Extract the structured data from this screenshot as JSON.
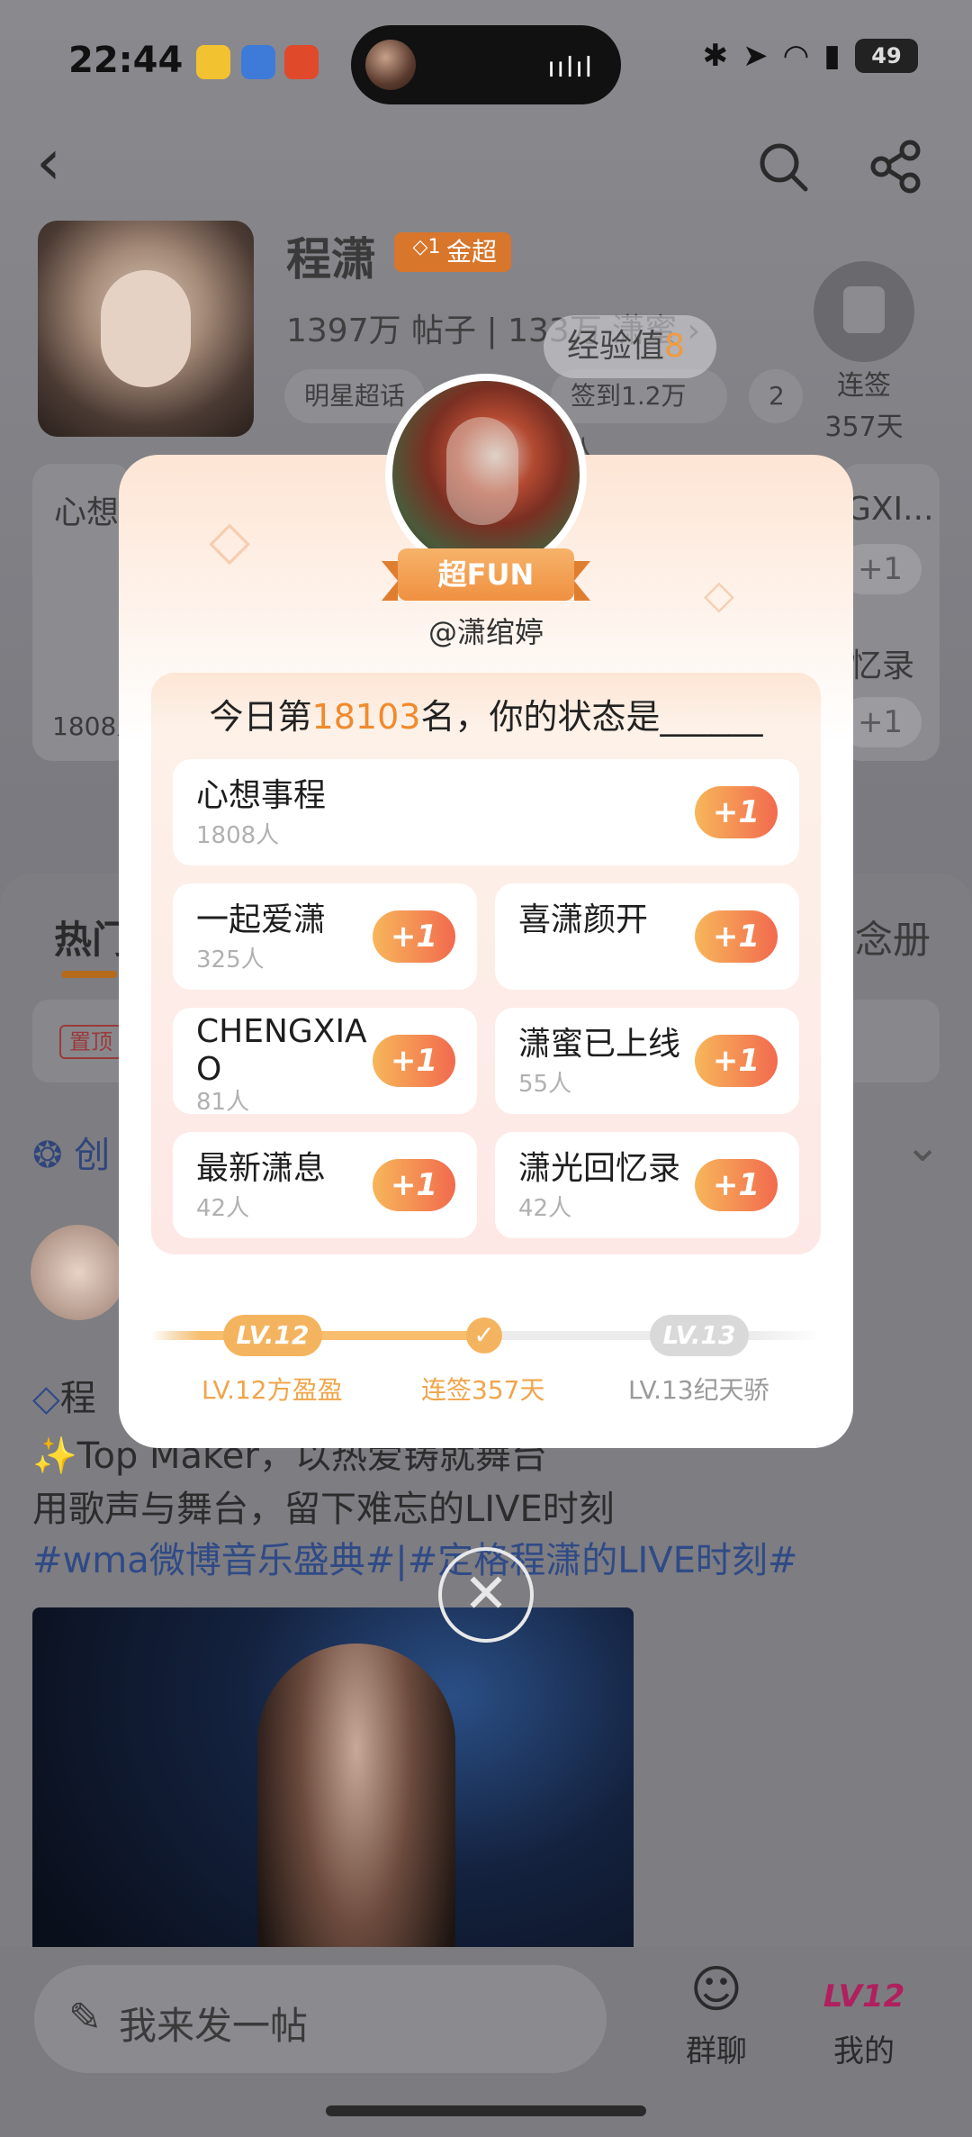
{
  "status_bar": {
    "time": "22:44",
    "battery": "49",
    "wave": "ıılıl"
  },
  "header": {
    "title": "程潇",
    "badge": "金超",
    "badge_num": "1",
    "stats": "1397万 帖子 | 133万 潇蜜 ›",
    "tags": [
      "明星超话",
      "签到1.2万人",
      "2"
    ],
    "checkin_label": "连签",
    "checkin_days": "357天",
    "exp_label": "经验值",
    "exp_value": "8"
  },
  "side_cards": {
    "left_title": "心想",
    "left_count": "1808人",
    "right_title": "GXI...",
    "right_title2": "忆录",
    "plus": "+1"
  },
  "tabs": {
    "hot": "热门",
    "right": "念册"
  },
  "pin": {
    "badge": "置顶"
  },
  "create": {
    "label": "创"
  },
  "post": {
    "line1": "程",
    "line2": "✨Top Maker，以热爱铸就舞台",
    "line3": "用歌声与舞台，留下难忘的LIVE时刻",
    "hashtags": "#wma微博音乐盛典#|#定格程潇的LIVE时刻#"
  },
  "bottom": {
    "compose_placeholder": "我来发一帖",
    "group_chat": "群聊",
    "mine": "我的",
    "mine_level": "LV12"
  },
  "modal": {
    "ribbon": "超FUN",
    "handle": "@潇绾婷",
    "rank_prefix": "今日第",
    "rank": "18103",
    "rank_suffix": "名，你的状态是______",
    "plus_label": "+1",
    "options": [
      {
        "name": "心想事程",
        "count": "1808人"
      },
      {
        "name": "一起爱潇",
        "count": "325人"
      },
      {
        "name": "喜潇颜开",
        "count": ""
      },
      {
        "name": "CHENGXIAO",
        "count": "81人"
      },
      {
        "name": "潇蜜已上线",
        "count": "55人"
      },
      {
        "name": "最新潇息",
        "count": "42人"
      },
      {
        "name": "潇光回忆录",
        "count": "42人"
      }
    ],
    "progress": {
      "current_level": "LV.12",
      "next_level": "LV.13",
      "current_label": "LV.12方盈盈",
      "middle_label": "连签357天",
      "next_label": "LV.13纪天骄",
      "fill_fraction": 0.5
    },
    "close_glyph": "✕"
  },
  "colors": {
    "accent_orange": "#f08a2e",
    "plus_gradient_start": "#f7b65a",
    "plus_gradient_end": "#f26a4e",
    "level_active": "#f4b45f"
  }
}
